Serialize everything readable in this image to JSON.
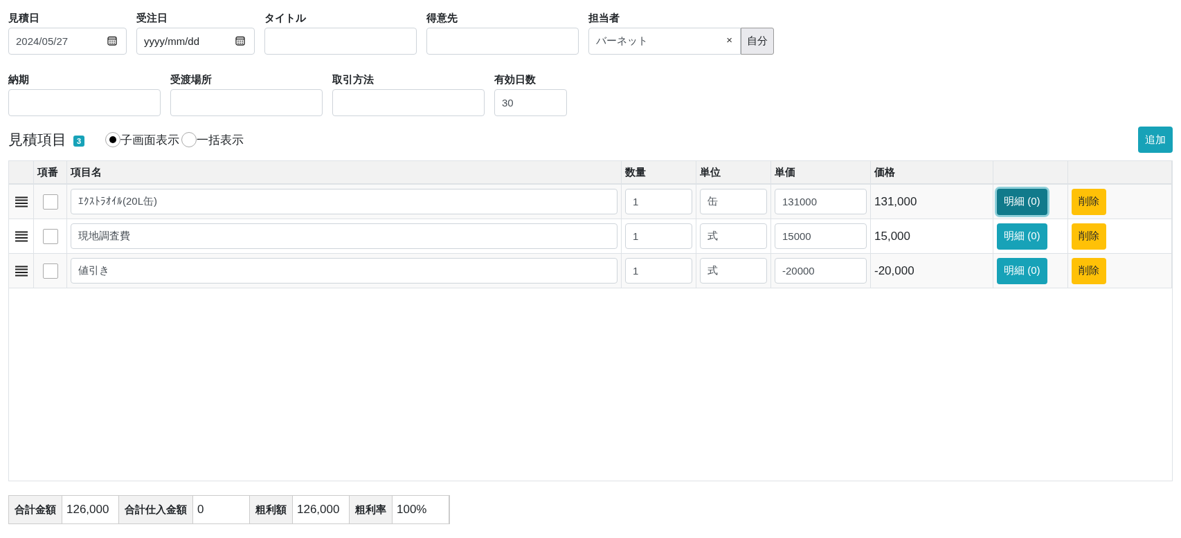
{
  "form_rows": [
    [
      {
        "label": "見積日",
        "kind": "date",
        "value": "2024/05/27"
      },
      {
        "label": "受注日",
        "kind": "date",
        "placeholder": "yyyy/mm/dd"
      },
      {
        "label": "タイトル",
        "kind": "text"
      },
      {
        "label": "得意先",
        "kind": "text"
      },
      {
        "label": "担当者",
        "kind": "select",
        "value": "バーネット",
        "clear": "×",
        "button": "自分"
      }
    ],
    [
      {
        "label": "納期",
        "kind": "text"
      },
      {
        "label": "受渡場所",
        "kind": "text"
      },
      {
        "label": "取引方法",
        "kind": "text"
      },
      {
        "label": "有効日数",
        "kind": "number",
        "value": "30"
      }
    ]
  ],
  "section": {
    "title": "見積項目",
    "count": "3",
    "view_options": [
      {
        "label": "子画面表示",
        "selected": true
      },
      {
        "label": "一括表示",
        "selected": false
      }
    ],
    "add_button": "追加"
  },
  "table": {
    "columns": [
      "項番",
      "項目名",
      "数量",
      "単位",
      "単価",
      "価格"
    ],
    "rows": [
      {
        "checked": false,
        "name": "ｴｸｽﾄﾗｵｲﾙ(20L缶)",
        "quantity": "1",
        "unit": "缶",
        "unit_price": "131000",
        "price": "131,000",
        "detail_button": "明細 (0)",
        "focused": true,
        "delete_button": "削除"
      },
      {
        "checked": false,
        "name": "現地調査費",
        "quantity": "1",
        "unit": "式",
        "unit_price": "15000",
        "price": "15,000",
        "detail_button": "明細 (0)",
        "focused": false,
        "delete_button": "削除"
      },
      {
        "checked": false,
        "name": "値引き",
        "quantity": "1",
        "unit": "式",
        "unit_price": "-20000",
        "price": "-20,000",
        "detail_button": "明細 (0)",
        "focused": false,
        "delete_button": "削除"
      }
    ]
  },
  "summary": [
    {
      "label": "合計金額",
      "value": "126,000"
    },
    {
      "label": "合計仕入金額",
      "value": "0"
    },
    {
      "label": "粗利額",
      "value": "126,000"
    },
    {
      "label": "粗利率",
      "value": "100%"
    }
  ]
}
